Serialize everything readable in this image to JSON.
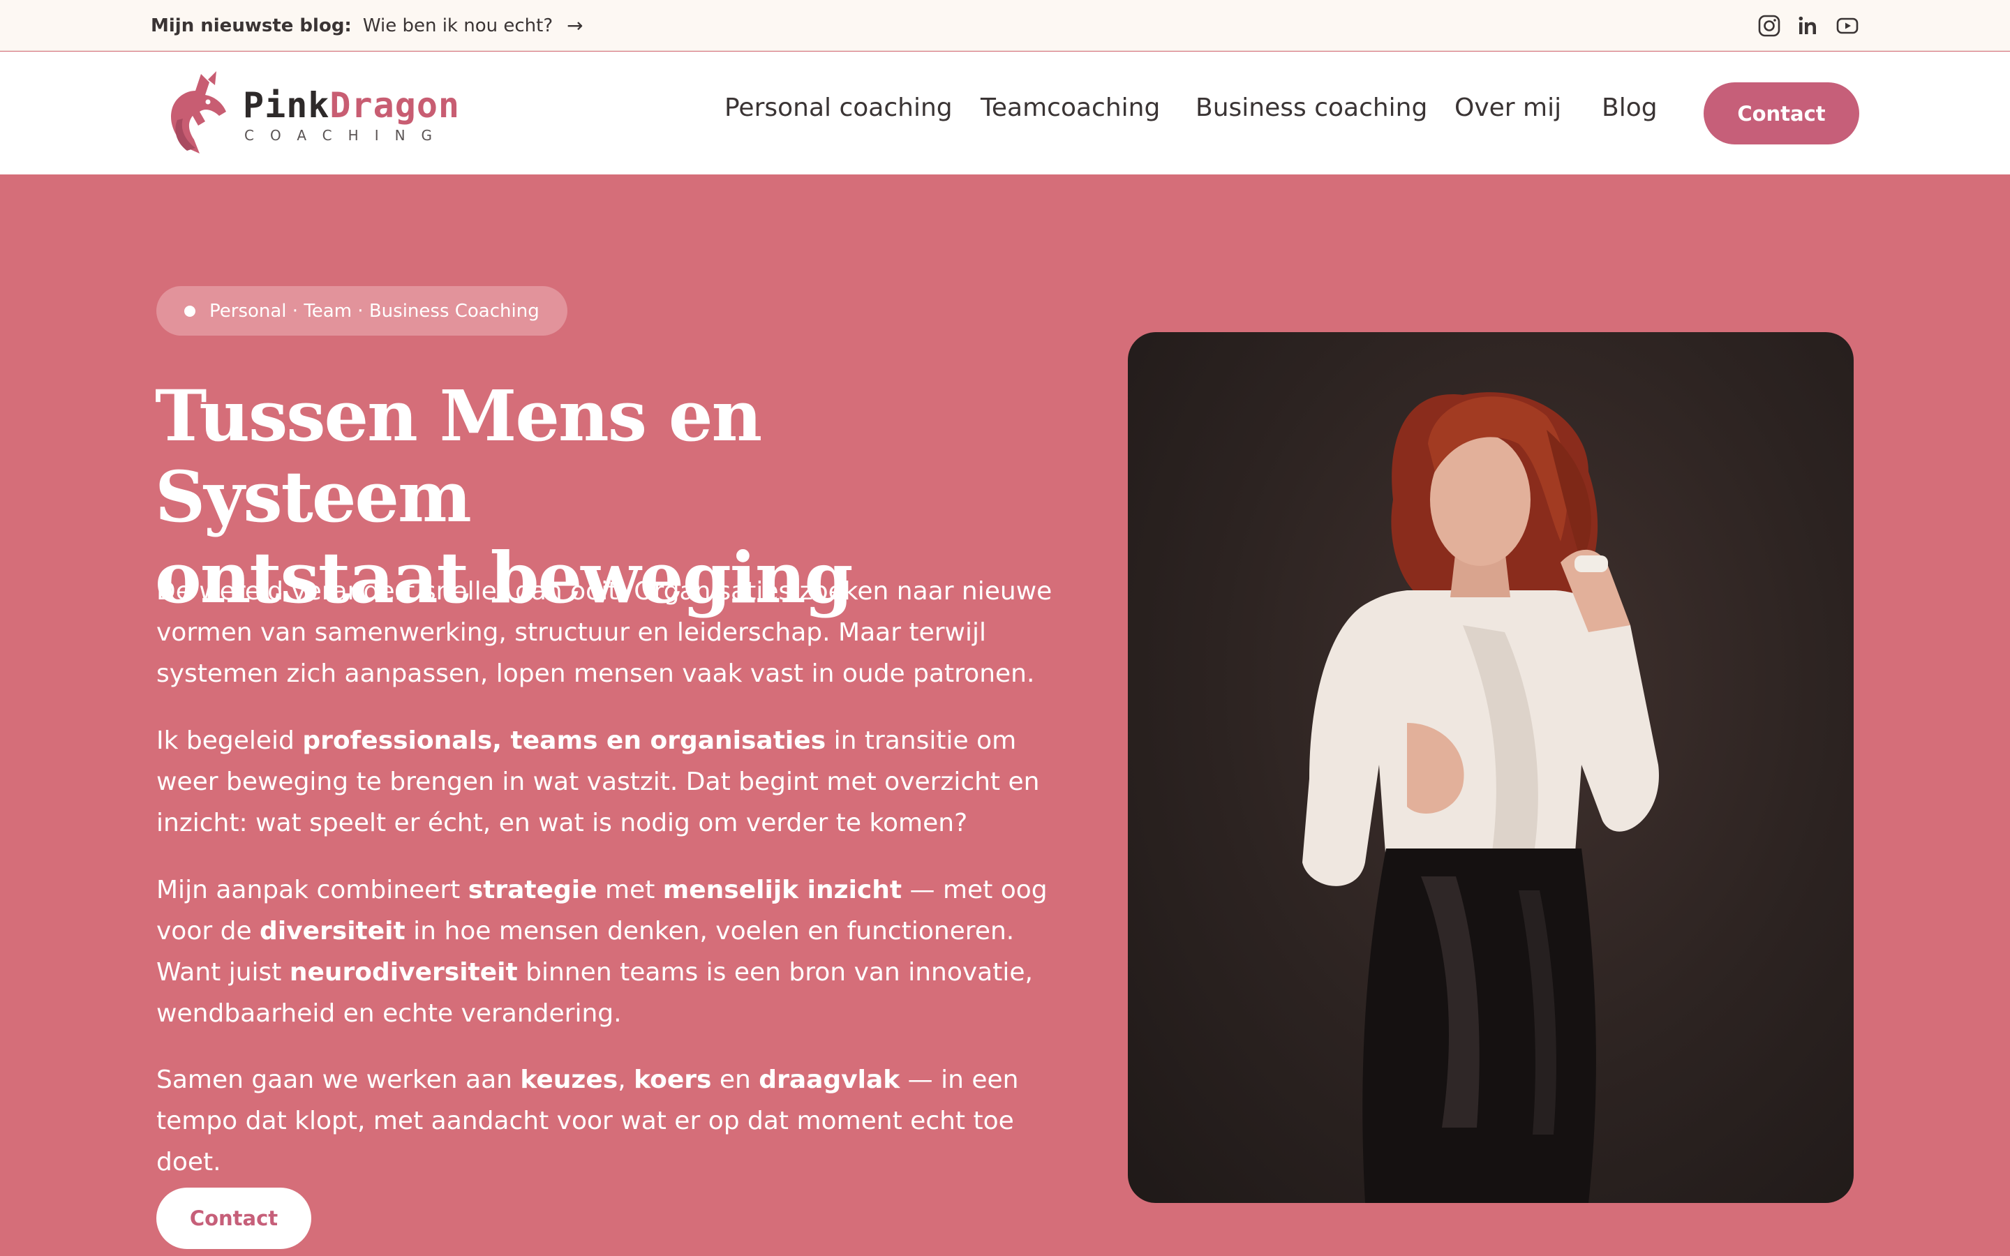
{
  "topbar": {
    "blog_label": "Mijn nieuwste blog:",
    "blog_title": "Wie ben ik nou echt?",
    "arrow": "→",
    "socials": [
      "instagram-icon",
      "linkedin-icon",
      "youtube-icon"
    ]
  },
  "header": {
    "logo": {
      "brand_part1": "Pink",
      "brand_part2": "Dragon",
      "tagline": "COACHING"
    },
    "nav": [
      "Personal coaching",
      "Teamcoaching",
      "Business coaching",
      "Over mij",
      "Blog"
    ],
    "contact_label": "Contact"
  },
  "hero": {
    "badge": "Personal · Team · Business Coaching",
    "title_line1": "Tussen Mens en Systeem",
    "title_line2": "ontstaat beweging",
    "p1": "De wereld verandert sneller dan ooit. Organisaties zoeken naar nieuwe vormen van samenwerking, structuur en leiderschap. Maar terwijl systemen zich aanpassen, lopen mensen vaak vast in oude patronen.",
    "p2": {
      "t1": "Ik begeleid ",
      "b1": "professionals, teams en organisaties",
      "t2": " in transitie om weer beweging te brengen in wat vastzit. Dat begint met overzicht en inzicht: wat speelt er écht, en wat is nodig om verder te komen?"
    },
    "p3": {
      "t1": "Mijn aanpak combineert ",
      "b1": "strategie",
      "t2": " met ",
      "b2": "menselijk inzicht",
      "t3": " — met oog voor de ",
      "b3": "diversiteit",
      "t4": " in hoe mensen denken, voelen en functioneren. Want juist ",
      "b4": "neurodiversiteit",
      "t5": " binnen teams is een bron van innovatie, wendbaarheid en echte verandering."
    },
    "p4": {
      "t1": "Samen gaan we werken aan ",
      "b1": "keuzes",
      "t2": ", ",
      "b2": "koers",
      "t3": " en ",
      "b3": "draagvlak",
      "t4": " — in een tempo dat klopt, met aandacht voor wat er op dat moment echt toe doet."
    },
    "cta_label": "Contact"
  },
  "colors": {
    "hero_bg": "#d56e79",
    "accent": "#c65f79",
    "topbar_bg": "#fdf8f3",
    "text_dark": "#3a3434"
  }
}
